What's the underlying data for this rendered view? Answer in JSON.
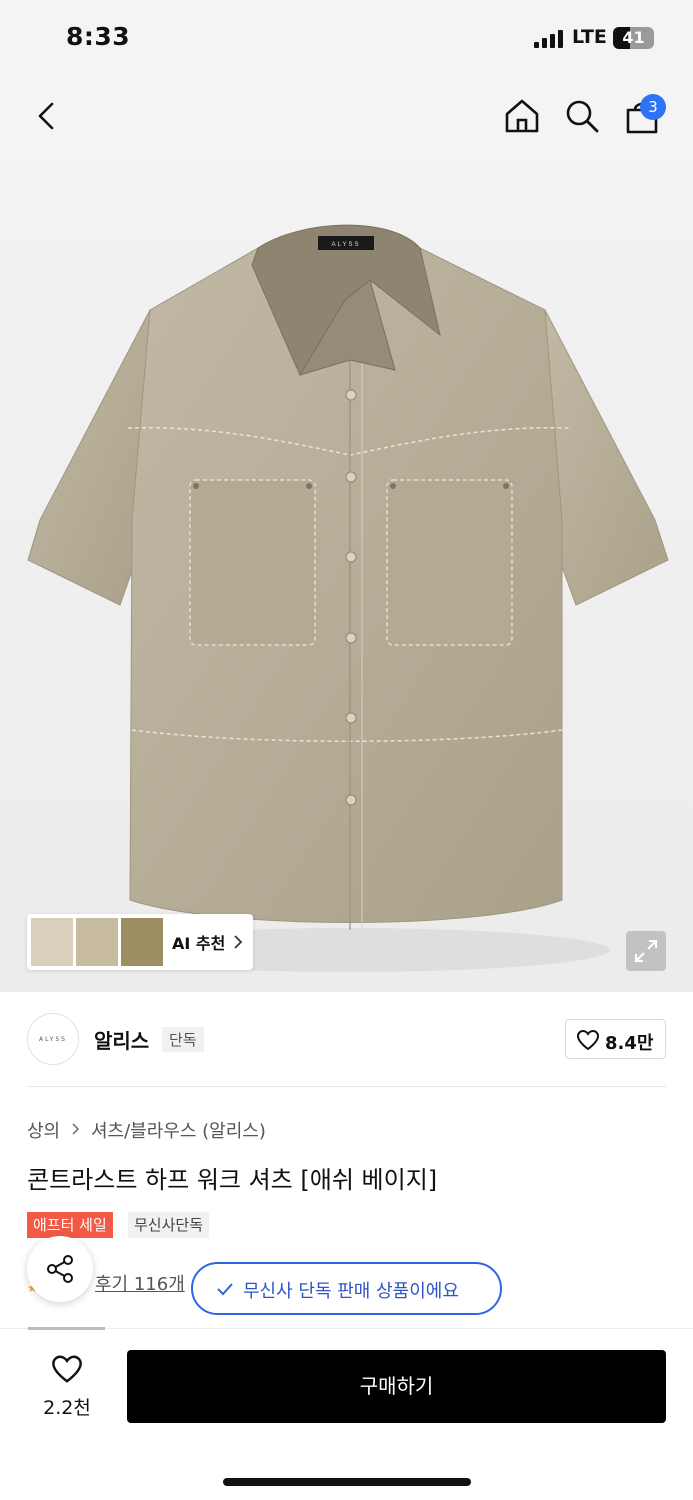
{
  "status_bar": {
    "time": "8:33",
    "network": "LTE",
    "battery": "41",
    "battery_level": 0.41,
    "signal_icon": "signal-bars-icon"
  },
  "nav": {
    "back_icon": "chevron-left-icon",
    "home_icon": "home-icon",
    "search_icon": "search-icon",
    "cart_icon": "shopping-bag-icon",
    "cart_count": "3"
  },
  "hero": {
    "collar_label": "ALYSS",
    "ai_recommend_label": "AI 추천",
    "expand_icon": "expand-icon",
    "colors": {
      "shirt": "#b7ae98",
      "collar": "#8e8470"
    }
  },
  "brand": {
    "logo_text": "ALYSS",
    "name": "알리스",
    "tag": "단독",
    "like_count": "8.4만"
  },
  "product": {
    "breadcrumb": [
      "상의",
      "셔츠/블라우스 (알리스)"
    ],
    "title": "콘트라스트 하프 워크 셔츠 [애쉬 베이지]",
    "badges": {
      "sale": "애프터 세일",
      "exclusive": "무신사단독"
    },
    "review_text": "후기 116개",
    "exclusive_notice": "무신사 단독 판매 상품이에요"
  },
  "bottom_bar": {
    "wish_count": "2.2천",
    "buy_label": "구매하기"
  },
  "accent_colors": {
    "primary_blue": "#2e66e0",
    "sale_red": "#f05a46"
  }
}
